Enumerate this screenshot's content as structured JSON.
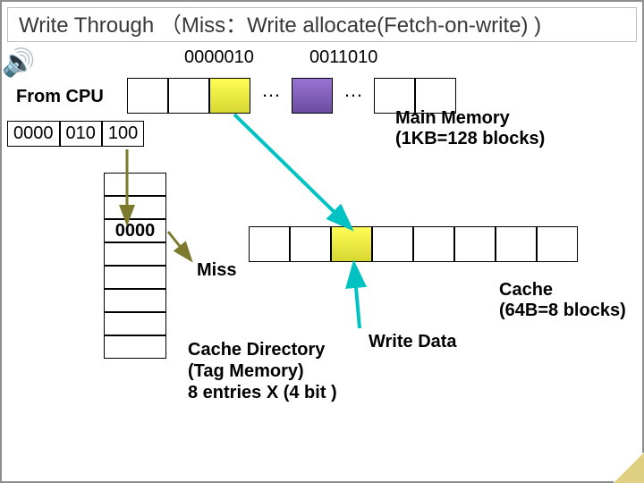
{
  "title": "Write Through （Miss：Write allocate(Fetch-on-write) )",
  "mem_addrs": {
    "a1": "0000010",
    "a2": "0011010"
  },
  "ellipsis": "…",
  "from_cpu": "From CPU",
  "cpu_addr": {
    "tag": "0000",
    "index": "010",
    "offset": "100"
  },
  "main_memory": {
    "line1": "Main Memory",
    "line2": "(1KB=128 blocks)"
  },
  "tag_value": "0000",
  "miss": "Miss",
  "cache": {
    "line1": "Cache",
    "line2": "(64B=8 blocks)"
  },
  "directory": {
    "line1": "Cache Directory",
    "line2": "(Tag Memory)",
    "line3": "8 entries X (4 bit )"
  },
  "write_data": "Write Data",
  "colors": {
    "highlight_yellow": "#fffd55",
    "highlight_purple": "#9a72d4",
    "arrow_cyan": "#00c2c2",
    "arrow_olive": "#7d7a2d"
  }
}
